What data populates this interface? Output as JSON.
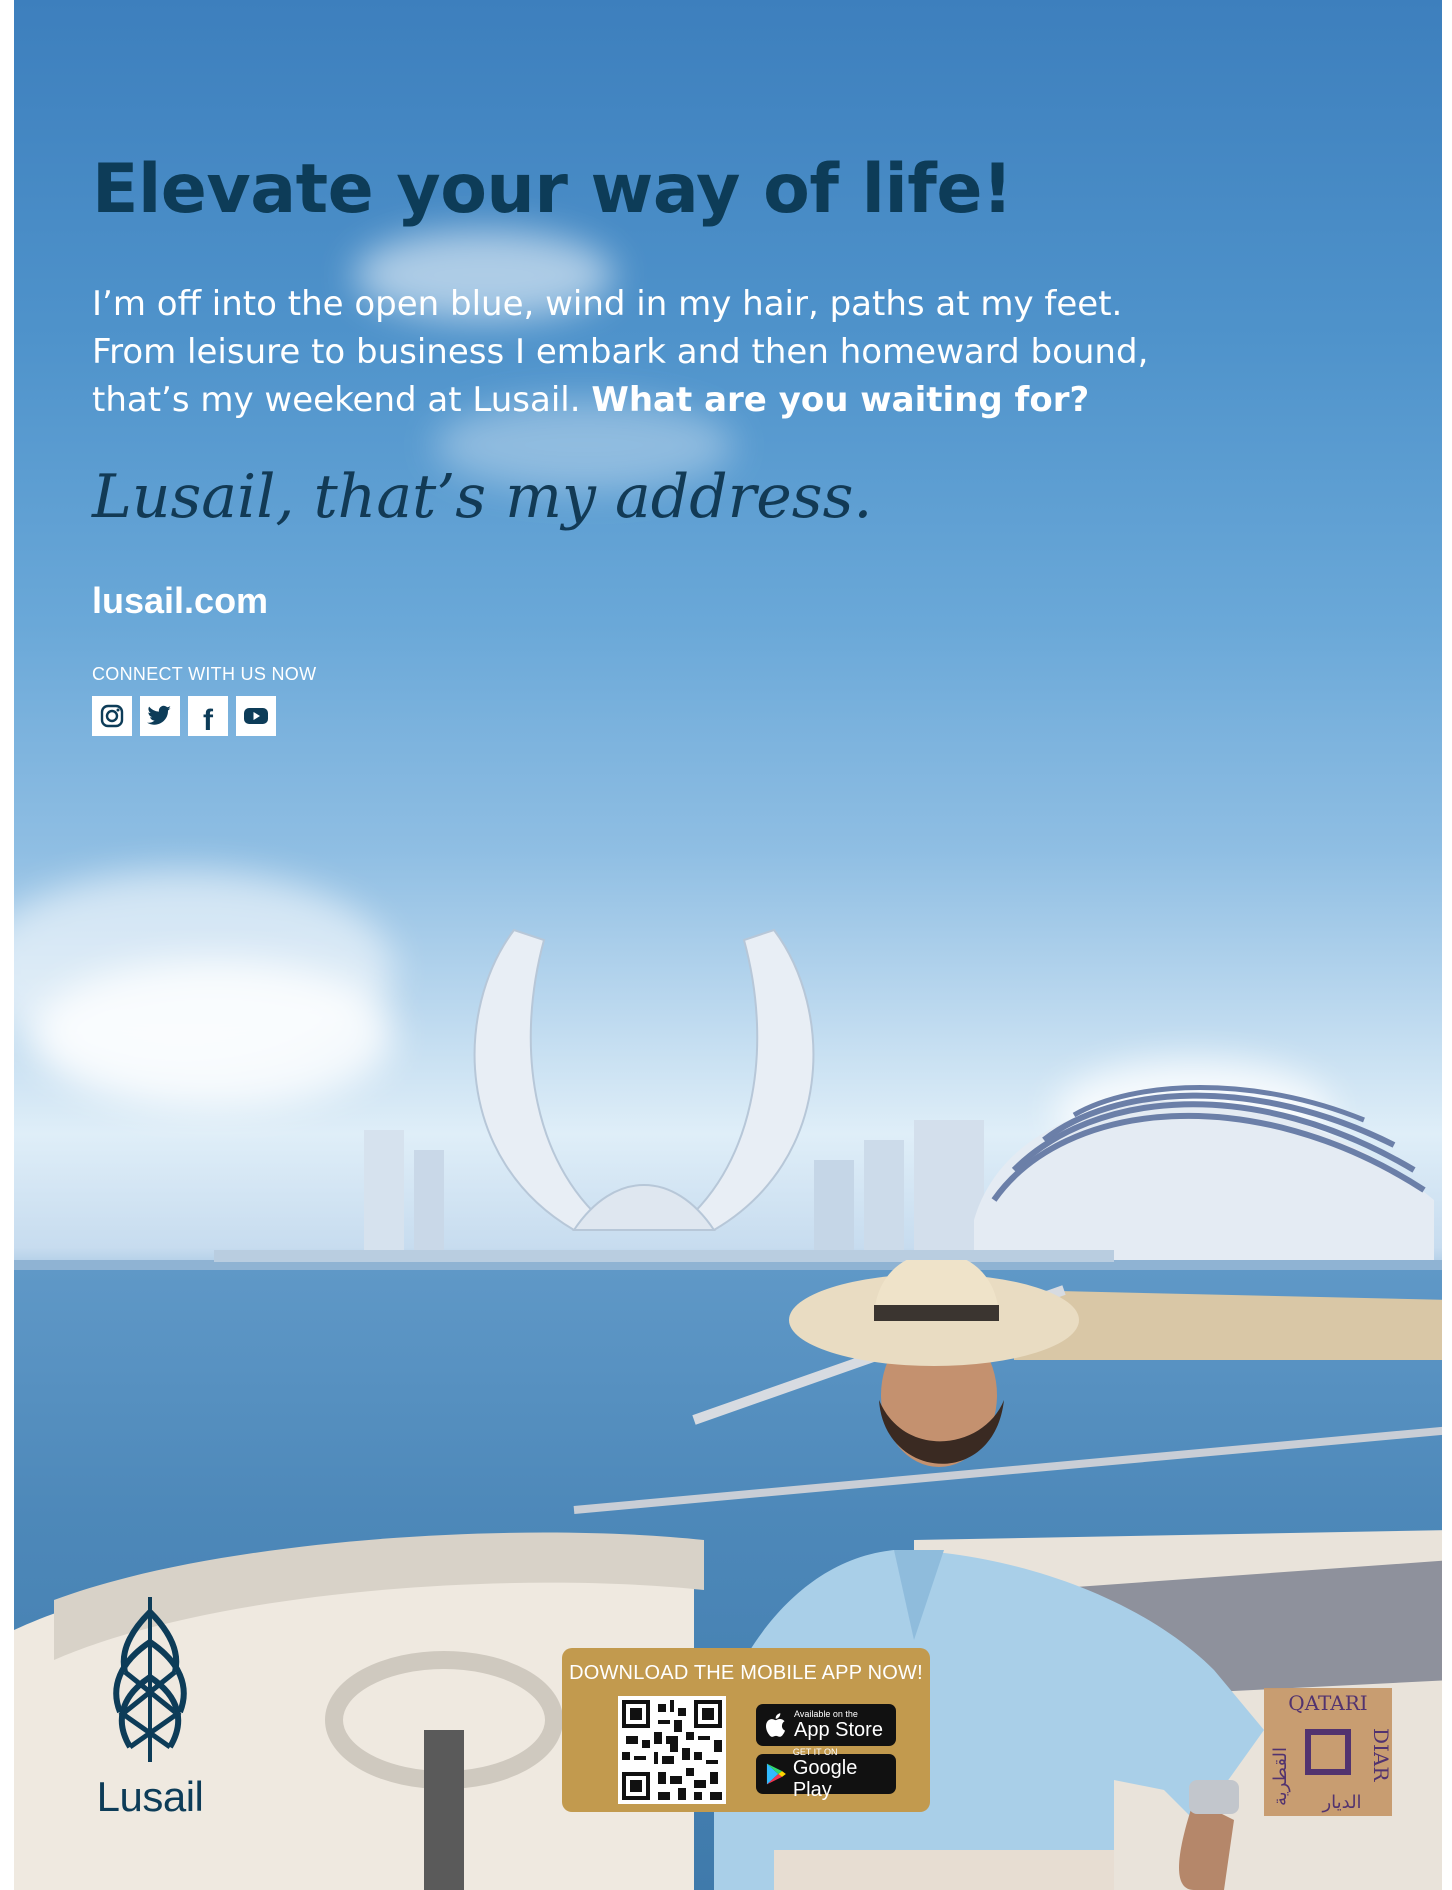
{
  "headline": "Elevate your way of life!",
  "body": {
    "line1": "I’m off into the open blue, wind in my hair, paths at my feet.",
    "line2": "From leisure to business I embark and then homeward bound,",
    "line3": "that’s my weekend at Lusail.",
    "cta": "What are you waiting for?"
  },
  "tagline": "Lusail, that’s my address.",
  "website": "lusail.com",
  "connect_label": "CONNECT WITH US NOW",
  "social": [
    {
      "name": "instagram-icon"
    },
    {
      "name": "twitter-icon"
    },
    {
      "name": "facebook-icon",
      "glyph": "f"
    },
    {
      "name": "youtube-icon"
    }
  ],
  "app_promo": {
    "title": "DOWNLOAD THE MOBILE APP NOW!",
    "appstore_small": "Available on the",
    "appstore_big": "App Store",
    "googleplay_small": "GET IT ON",
    "googleplay_big": "Google Play"
  },
  "logos": {
    "lusail": "Lusail",
    "qatari_diar_en_1": "QATARI",
    "qatari_diar_en_2": "DIAR",
    "qatari_diar_ar_1": "القطرية",
    "qatari_diar_ar_2": "الديار"
  },
  "colors": {
    "navy": "#0d3c58",
    "gold": "#c29a4e",
    "sky": "#4f93cb"
  }
}
